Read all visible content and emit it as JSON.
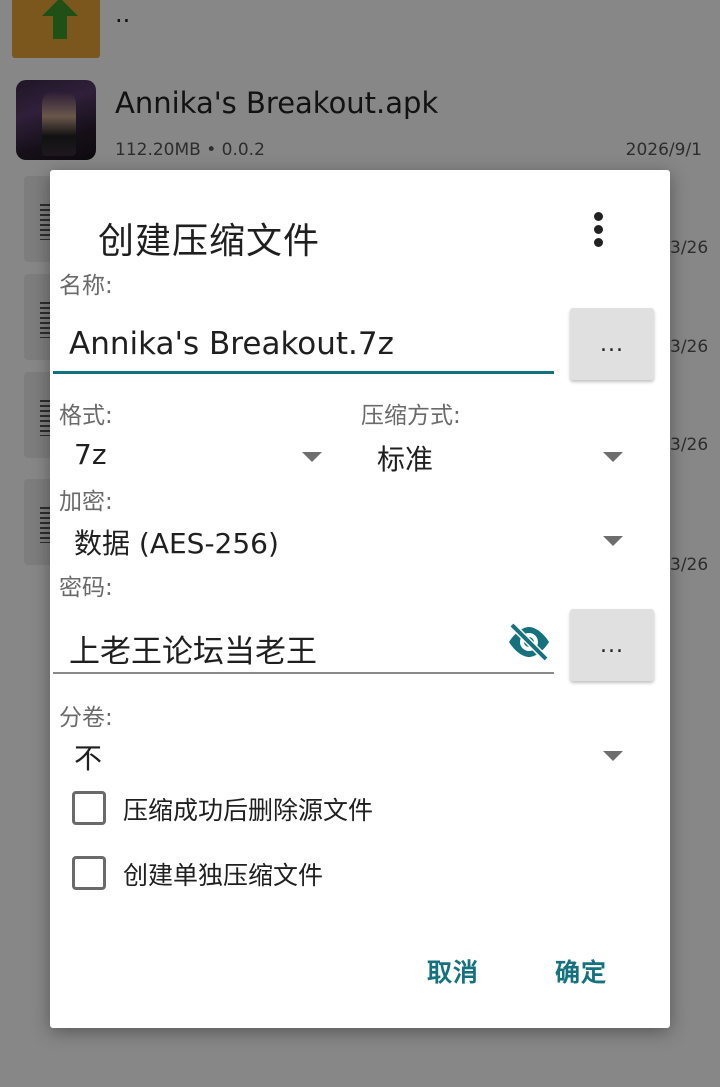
{
  "background": {
    "up_label": "..",
    "apk": {
      "name": "Annika's Breakout.apk",
      "meta": "112.20MB  •  0.0.2",
      "date": "2026/9/1"
    },
    "side_dates": [
      "3/26",
      "3/26",
      "3/26",
      "3/26"
    ]
  },
  "dialog": {
    "title": "创建压缩文件",
    "name_label": "名称:",
    "name_value": "Annika's Breakout.7z",
    "browse_label": "...",
    "format_label": "格式:",
    "format_value": "7z",
    "method_label": "压缩方式:",
    "method_value": "标准",
    "encryption_label": "加密:",
    "encryption_value": "数据 (AES-256)",
    "password_label": "密码:",
    "password_value": "上老王论坛当老王",
    "password_more_label": "...",
    "split_label": "分卷:",
    "split_value": "不",
    "delete_source_label": "压缩成功后删除源文件",
    "delete_source_checked": false,
    "separate_archives_label": "创建单独压缩文件",
    "separate_archives_checked": false,
    "cancel_label": "取消",
    "ok_label": "确定",
    "accent_color": "#14717e"
  }
}
